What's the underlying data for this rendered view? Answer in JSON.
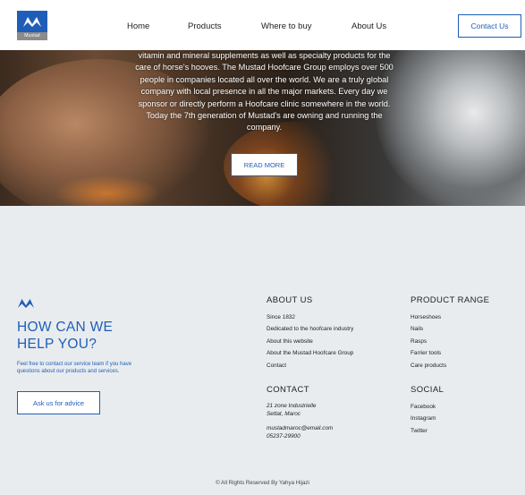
{
  "header": {
    "logo_text": "Mustad",
    "nav": [
      "Home",
      "Products",
      "Where to buy",
      "About Us"
    ],
    "contact_label": "Contact Us",
    "brand_color": "#1f5eb8"
  },
  "hero": {
    "text_lines": [
      "vitamin and mineral supplements as well as specialty products for the",
      "care of horse's hooves. The Mustad Hoofcare Group employs over 500",
      "people in companies located all over the world. We are a truly global",
      "company with local presence in all the major markets. Every day we",
      "sponsor or directly perform a Hoofcare clinic somewhere in the world.",
      "Today the 7th generation of Mustad's are owning and running the",
      "company."
    ],
    "read_more_label": "READ MORE"
  },
  "help": {
    "title": "HOW CAN WE HELP YOU?",
    "subtitle": "Feel free to contact our service team if you have questions about our products and services.",
    "advice_label": "Ask us for advice"
  },
  "about": {
    "title": "ABOUT US",
    "items": [
      "Since 1832",
      "Dedicated to the hoofcare industry",
      "About this website",
      "About the Mustad Hoofcare Group",
      "Contact"
    ]
  },
  "products": {
    "title": "PRODUCT RANGE",
    "items": [
      "Horseshoes",
      "Nails",
      "Rasps",
      "Farrier tools",
      "Care products"
    ]
  },
  "contact": {
    "title": "CONTACT",
    "address_line1": "21 zone Industrielle",
    "address_line2": "Settat, Maroc",
    "email": "mustadmaroc@email.com",
    "phone": "05237-29900"
  },
  "social": {
    "title": "SOCIAL",
    "items": [
      "Facebook",
      "Instagram",
      "Twitter"
    ]
  },
  "footer": {
    "copyright": "© All Rights Reserved By Yahya Hijazi"
  }
}
